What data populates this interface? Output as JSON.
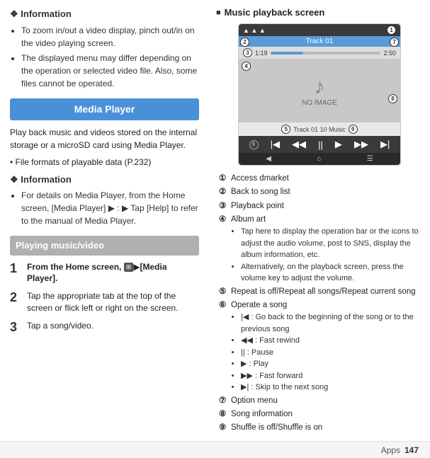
{
  "left": {
    "info_title": "Information",
    "info_items": [
      "To zoom in/out a video display, pinch out/in on the video playing screen.",
      "The displayed menu may differ depending on the operation or selected video file. Also, some files cannot be operated."
    ],
    "media_player_banner": "Media Player",
    "media_player_intro": "Play back music and videos stored on the internal storage or a microSD card using Media Player.",
    "media_player_file_formats": "File formats of playable data (P.232)",
    "info2_title": "Information",
    "info2_items": [
      "For details on Media Player, from the Home screen, [Media Player] ▶ : ▶ Tap [Help] to refer to the manual of Media Player."
    ],
    "playing_banner": "Playing music/video",
    "steps": [
      {
        "num": "1",
        "text": "From the Home screen,  ▶[Media Player]."
      },
      {
        "num": "2",
        "text": "Tap the appropriate tab at the top of the screen or flick left or right on the screen."
      },
      {
        "num": "3",
        "text": "Tap a song/video."
      }
    ]
  },
  "right": {
    "section_header": "Music playback screen",
    "player": {
      "track_name": "Track 01",
      "time_start": "1:19",
      "time_end": "2:50",
      "no_image_text": "NO IMAGE",
      "track_info_label": "Track 01 10 Music"
    },
    "annotations": [
      {
        "num": "①",
        "text": "Access dmarket"
      },
      {
        "num": "②",
        "text": "Back to song list"
      },
      {
        "num": "③",
        "text": "Playback point"
      },
      {
        "num": "④",
        "text": "Album art",
        "subitems": [
          "Tap here to display the operation bar or the icons to adjust the audio volume, post to SNS, display the album information, etc.",
          "Alternatively, on the playback screen, press the volume key to adjust the volume."
        ]
      },
      {
        "num": "⑤",
        "text": "Repeat is off/Repeat all songs/Repeat current song"
      },
      {
        "num": "⑥",
        "text": "Operate a song",
        "subitems": [
          "|◀ : Go back to the beginning of the song or to the previous song",
          "◀◀ : Fast rewind",
          "|| : Pause",
          "▶ : Play",
          "▶▶ : Fast forward",
          "▶| : Skip to the next song"
        ]
      },
      {
        "num": "⑦",
        "text": "Option menu"
      },
      {
        "num": "⑧",
        "text": "Song information"
      },
      {
        "num": "⑨",
        "text": "Shuffle is off/Shuffle is on"
      }
    ]
  },
  "footer": {
    "apps_label": "Apps",
    "page_number": "147"
  }
}
